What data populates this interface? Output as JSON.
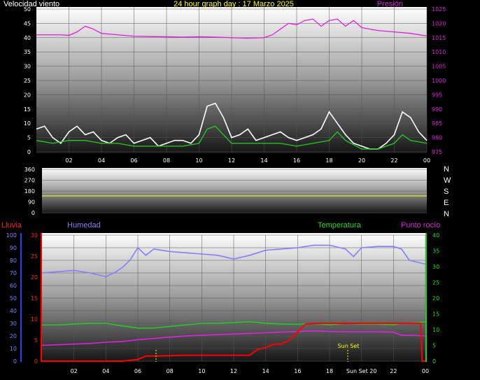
{
  "header": {
    "title": "24 hour graph day : 17 Marzo 2025",
    "wind_label": "Velocidad viento",
    "pressure_label": "Presión"
  },
  "direction_labels": [
    "N",
    "W",
    "S",
    "E",
    "N"
  ],
  "bottom_labels": {
    "rain": "Lluvia",
    "humidity": "Humedad",
    "temperature": "Temperatura",
    "dewpoint": "Punto rocío",
    "sunset": "Sun Set",
    "sunset_x": "Sun Set 20"
  },
  "colors": {
    "background": "#000000",
    "wind": "#FFFFFF",
    "wind_avg": "#22CC22",
    "pressure": "#E020E0",
    "direction": "#E0E020",
    "humidity": "#8080FF",
    "temperature": "#22CC22",
    "dewpoint": "#E020E0",
    "rain": "#FF0000",
    "rain_axis": "#2040FF"
  },
  "chart_data": [
    {
      "type": "line",
      "title": "24 hour graph day : 17 Marzo 2025",
      "x_ticks": [
        "02",
        "04",
        "06",
        "08",
        "10",
        "12",
        "14",
        "16",
        "18",
        "20",
        "22",
        "00"
      ],
      "y_left_ticks": [
        "0",
        "5",
        "10",
        "15",
        "20",
        "25",
        "30",
        "35",
        "40",
        "45",
        "50"
      ],
      "y_right_ticks": [
        "975",
        "980",
        "985",
        "990",
        "995",
        "1000",
        "1005",
        "1010",
        "1015",
        "1020",
        "1025"
      ],
      "ylim_left": [
        0,
        50
      ],
      "ylim_right": [
        975,
        1025
      ],
      "series": [
        {
          "name": "Velocidad viento",
          "axis": "left",
          "x": [
            0,
            0.5,
            1,
            1.5,
            2,
            2.5,
            3,
            3.5,
            4,
            4.5,
            5,
            5.5,
            6,
            6.5,
            7,
            7.5,
            8,
            8.5,
            9,
            9.5,
            10,
            10.5,
            11,
            11.5,
            12,
            12.5,
            13,
            13.5,
            14,
            14.5,
            15,
            15.5,
            16,
            16.5,
            17,
            17.5,
            18,
            18.5,
            19,
            19.5,
            20,
            20.5,
            21,
            21.5,
            22,
            22.5,
            23,
            23.5,
            24
          ],
          "values": [
            8,
            9,
            5,
            3,
            7,
            9,
            6,
            7,
            4,
            3,
            5,
            6,
            3,
            4,
            5,
            2,
            3,
            4,
            4,
            3,
            6,
            16,
            17,
            12,
            5,
            6,
            8,
            4,
            5,
            6,
            7,
            5,
            4,
            5,
            6,
            8,
            14,
            10,
            6,
            3,
            2,
            1,
            1,
            3,
            6,
            14,
            12,
            7,
            4
          ]
        },
        {
          "name": "Wind average",
          "axis": "left",
          "x": [
            0,
            1,
            2,
            3,
            4,
            5,
            6,
            7,
            8,
            9,
            10,
            10.5,
            11,
            11.5,
            12,
            13,
            14,
            15,
            16,
            17,
            18,
            18.5,
            19,
            20,
            21,
            22,
            22.5,
            23,
            24
          ],
          "values": [
            4,
            3,
            4,
            4,
            3,
            3,
            2,
            2,
            2,
            2,
            3,
            8,
            9,
            6,
            3,
            3,
            3,
            3,
            2,
            3,
            4,
            7,
            4,
            1,
            1,
            3,
            6,
            4,
            3
          ]
        },
        {
          "name": "Presión",
          "axis": "right",
          "x": [
            0,
            1,
            1.5,
            2,
            2.5,
            3,
            3.5,
            4,
            5,
            6,
            7,
            8,
            9,
            10,
            11,
            12,
            13,
            14,
            14.5,
            15,
            15.5,
            16,
            16.5,
            17,
            17.5,
            18,
            18.5,
            19,
            19.5,
            20,
            21,
            22,
            23,
            24
          ],
          "values": [
            1016,
            1016,
            1016,
            1015.8,
            1017,
            1019,
            1018,
            1016.5,
            1016,
            1015.5,
            1015.4,
            1015.3,
            1015.2,
            1015.3,
            1015.2,
            1015,
            1014.8,
            1015,
            1016,
            1018,
            1020,
            1019.5,
            1021,
            1021.5,
            1019,
            1021,
            1021.5,
            1019,
            1021,
            1018.5,
            1017.5,
            1017,
            1016.5,
            1015.6
          ]
        }
      ]
    },
    {
      "type": "line",
      "y_left_ticks": [
        "0",
        "90",
        "180",
        "270",
        "360"
      ],
      "ylim": [
        0,
        360
      ],
      "series": [
        {
          "name": "Wind direction",
          "x": [
            0,
            24
          ],
          "values": [
            140,
            140
          ]
        }
      ]
    },
    {
      "type": "line",
      "x_ticks": [
        "02",
        "04",
        "06",
        "08",
        "10",
        "12",
        "14",
        "16",
        "18",
        "20",
        "22",
        "00"
      ],
      "y_humidity_ticks": [
        "0",
        "10",
        "20",
        "30",
        "40",
        "50",
        "60",
        "70",
        "80",
        "90",
        "100"
      ],
      "y_rain_ticks": [
        "0",
        "5",
        "10",
        "15",
        "20",
        "25",
        "30"
      ],
      "y_temp_ticks": [
        "0",
        "5",
        "10",
        "15",
        "20",
        "25",
        "30",
        "35",
        "40"
      ],
      "ylim_humidity": [
        0,
        100
      ],
      "ylim_rain": [
        0,
        30
      ],
      "ylim_temp": [
        0,
        40
      ],
      "series": [
        {
          "name": "Humedad",
          "axis": "humidity",
          "x": [
            0,
            1,
            2,
            3,
            4,
            4.5,
            5,
            5.5,
            6,
            6.5,
            7,
            8,
            9,
            10,
            11,
            12,
            13,
            14,
            15,
            16,
            17,
            18,
            19,
            19.5,
            20,
            21,
            22,
            22.5,
            23,
            24
          ],
          "values": [
            70,
            71,
            72,
            70,
            67,
            70,
            74,
            80,
            90,
            84,
            89,
            87,
            86,
            85,
            84,
            81,
            84,
            88,
            89,
            90,
            92,
            92,
            89,
            83,
            90,
            91,
            91,
            89,
            80,
            77
          ]
        },
        {
          "name": "Temperatura",
          "axis": "temp",
          "x": [
            0,
            1,
            2,
            3,
            4,
            5,
            6,
            7,
            8,
            9,
            10,
            11,
            12,
            13,
            14,
            15,
            16,
            17,
            18,
            19,
            20,
            21,
            22,
            22.5,
            23,
            24
          ],
          "values": [
            11.5,
            11.5,
            11.8,
            12,
            12,
            11.2,
            10.5,
            10.5,
            11,
            11.5,
            12,
            12,
            12.2,
            12.5,
            12,
            11.8,
            11.7,
            12,
            11.5,
            12,
            11.8,
            11.8,
            11.5,
            12,
            12,
            12.5
          ]
        },
        {
          "name": "Punto rocío",
          "axis": "temp",
          "x": [
            0,
            1,
            2,
            3,
            4,
            5,
            6,
            7,
            8,
            9,
            10,
            11,
            12,
            13,
            14,
            15,
            16,
            17,
            18,
            19,
            20,
            21,
            22,
            22.5,
            23,
            24
          ],
          "values": [
            5,
            5.2,
            5.4,
            5.6,
            6,
            6.2,
            6.8,
            7.2,
            7.6,
            8,
            8.2,
            8.4,
            8.6,
            8.8,
            9,
            9.2,
            9.4,
            9.6,
            9.4,
            9.3,
            9.3,
            9.3,
            9.2,
            8.2,
            8.2,
            8
          ]
        },
        {
          "name": "Lluvia",
          "axis": "rain",
          "x": [
            0,
            1,
            2,
            3,
            4,
            5,
            6,
            6.5,
            7,
            8,
            9,
            10,
            11,
            12,
            13,
            13.5,
            14,
            14.5,
            15,
            15.5,
            16,
            16.5,
            17,
            18,
            19,
            20,
            21,
            22,
            23,
            23.7,
            23.8,
            24
          ],
          "values": [
            0,
            0,
            0,
            0,
            0,
            0,
            0.4,
            1.2,
            1.2,
            1.3,
            1.4,
            1.4,
            1.4,
            1.4,
            1.4,
            2.8,
            3.2,
            4.0,
            4.1,
            5,
            7,
            8.8,
            9,
            9,
            9,
            9,
            9,
            9,
            9,
            9,
            0,
            0
          ]
        }
      ]
    }
  ]
}
